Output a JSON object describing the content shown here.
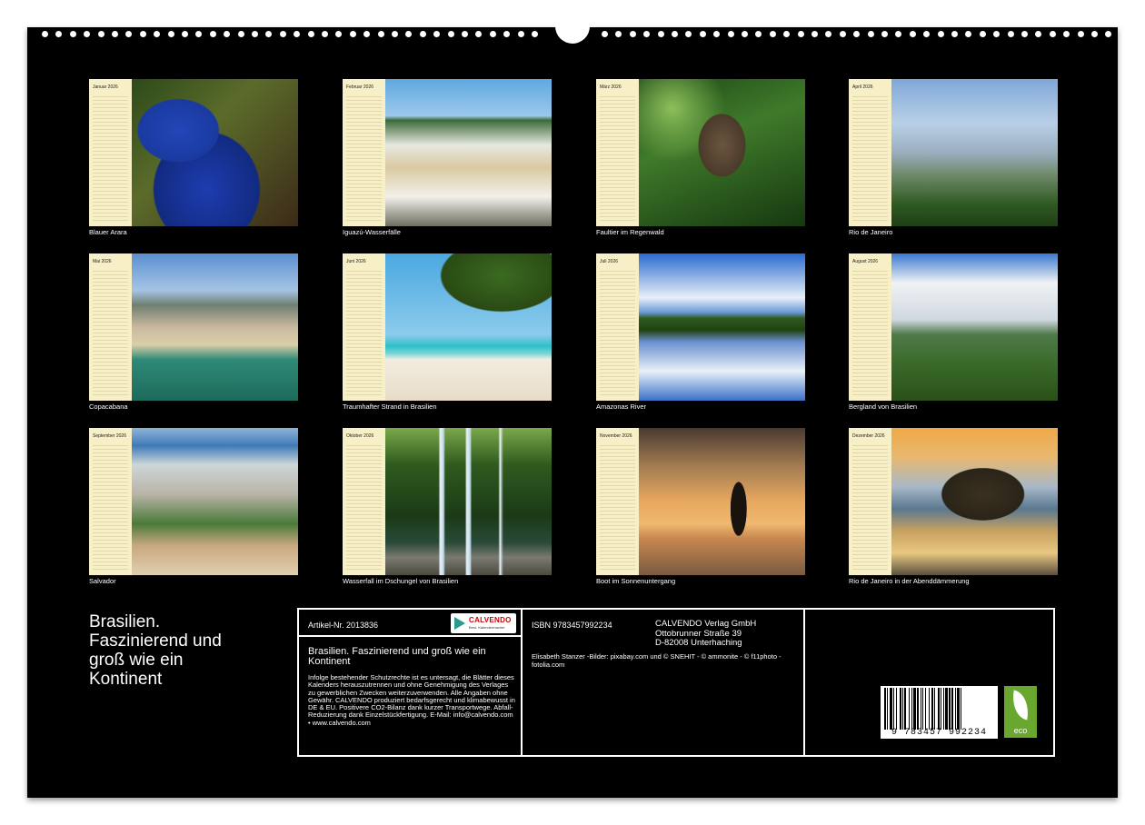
{
  "sheet": {
    "title_lines": [
      "Brasilien.",
      "Faszinierend und",
      "groß wie ein",
      "Kontinent"
    ]
  },
  "tiles": [
    {
      "month": "Januar 2026",
      "caption": "Blauer Arara"
    },
    {
      "month": "Februar 2026",
      "caption": "Iguazú-Wasserfälle"
    },
    {
      "month": "März 2026",
      "caption": "Faultier im Regenwald"
    },
    {
      "month": "April 2026",
      "caption": "Rio de Janeiro"
    },
    {
      "month": "Mai 2026",
      "caption": "Copacabana"
    },
    {
      "month": "Juni 2026",
      "caption": "Traumhafter Strand in Brasilien"
    },
    {
      "month": "Juli 2026",
      "caption": "Amazonas River"
    },
    {
      "month": "August 2026",
      "caption": "Bergland von Brasilien"
    },
    {
      "month": "September 2026",
      "caption": "Salvador"
    },
    {
      "month": "Oktober 2026",
      "caption": "Wasserfall im Dschungel von Brasilien"
    },
    {
      "month": "November 2026",
      "caption": "Boot im Sonnenuntergang"
    },
    {
      "month": "Dezember 2026",
      "caption": "Rio de Janeiro in der Abenddämmerung"
    }
  ],
  "info": {
    "article": "Artikel-Nr. 2013836",
    "logo_brand": "CALVENDO",
    "logo_tag": "Best. Kalendermacher",
    "title_box": "Brasilien. Faszinierend und groß wie ein Kontinent",
    "legal": "Infolge bestehender Schutzrechte ist es untersagt, die Blätter dieses Kalenders herauszutrennen und ohne Genehmigung des Verlages zu gewerblichen Zwecken weiterzuverwenden. Alle Angaben ohne Gewähr. CALVENDO produziert bedarfsgerecht und klimabewusst in DE & EU. Positivere CO2-Bilanz dank kurzer Transportwege. Abfall-Reduzierung dank Einzelstückfertigung. E-Mail: info@calvendo.com • www.calvendo.com",
    "isbn": "ISBN 9783457992234",
    "publisher_lines": [
      "CALVENDO Verlag GmbH",
      "Ottobrunner Straße 39",
      "D-82008 Unterhaching"
    ],
    "credits": "Elisabeth Stanzer -Bilder: pixabay.com und © SNEHIT - © ammonite - © f11photo - fotolia.com",
    "barcode_digits": "9 783457 992234",
    "eco_label": "eco"
  }
}
